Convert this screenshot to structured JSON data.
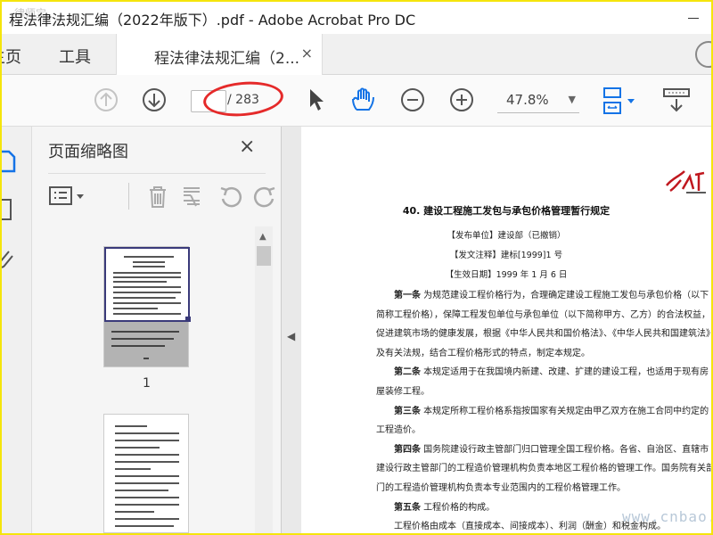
{
  "window": {
    "title": "程法律法规汇编（2022年版下）.pdf - Adobe Acrobat Pro DC",
    "watermark_top": "律师宝"
  },
  "tabs": {
    "home": "主页",
    "tools": "工具",
    "doc_tab": "程法律法规汇编（2...",
    "close": "×"
  },
  "toolbar": {
    "page_current": "",
    "page_total": "/ 283",
    "zoom": "47.8%"
  },
  "panel": {
    "title": "页面缩略图",
    "close": "×",
    "thumb1_label": "1"
  },
  "document": {
    "logo_text": "律天",
    "title": "40. 建设工程施工发包与承包价格管理暂行规定",
    "publisher": "【发布单位】建设部（已撤销）",
    "doc_no": "【发文注释】建标[1999]1 号",
    "effective": "【生效日期】1999 年 1 月 6 日",
    "lines": [
      {
        "bold": "第一条",
        "text": " 为规范建设工程价格行为，合理确定建设工程施工发包与承包价格（以下"
      },
      {
        "bold": "",
        "text": "简称工程价格），保障工程发包单位与承包单位（以下简称甲方、乙方）的合法权益，"
      },
      {
        "bold": "",
        "text": "促进建筑市场的健康发展，根据《中华人民共和国价格法》、《中华人民共和国建筑法》"
      },
      {
        "bold": "",
        "text": "及有关法规，结合工程价格形式的特点，制定本规定。"
      },
      {
        "bold": "第二条",
        "text": " 本规定适用于在我国境内新建、改建、扩建的建设工程，也适用于现有房"
      },
      {
        "bold": "",
        "text": "屋装修工程。"
      },
      {
        "bold": "第三条",
        "text": " 本规定所称工程价格系指按国家有关规定由甲乙双方在施工合同中约定的"
      },
      {
        "bold": "",
        "text": "工程造价。"
      },
      {
        "bold": "第四条",
        "text": " 国务院建设行政主管部门归口管理全国工程价格。各省、自治区、直辖市"
      },
      {
        "bold": "",
        "text": "建设行政主管部门的工程造价管理机构负责本地区工程价格的管理工作。国务院有关部"
      },
      {
        "bold": "",
        "text": "门的工程造价管理机构负责本专业范围内的工程价格管理工作。"
      },
      {
        "bold": "第五条",
        "text": " 工程价格的构成。"
      },
      {
        "bold": "",
        "text": "工程价格由成本（直接成本、间接成本）、利润（酬金）和税金构成。"
      }
    ],
    "watermark": "www.cnbao.com"
  }
}
